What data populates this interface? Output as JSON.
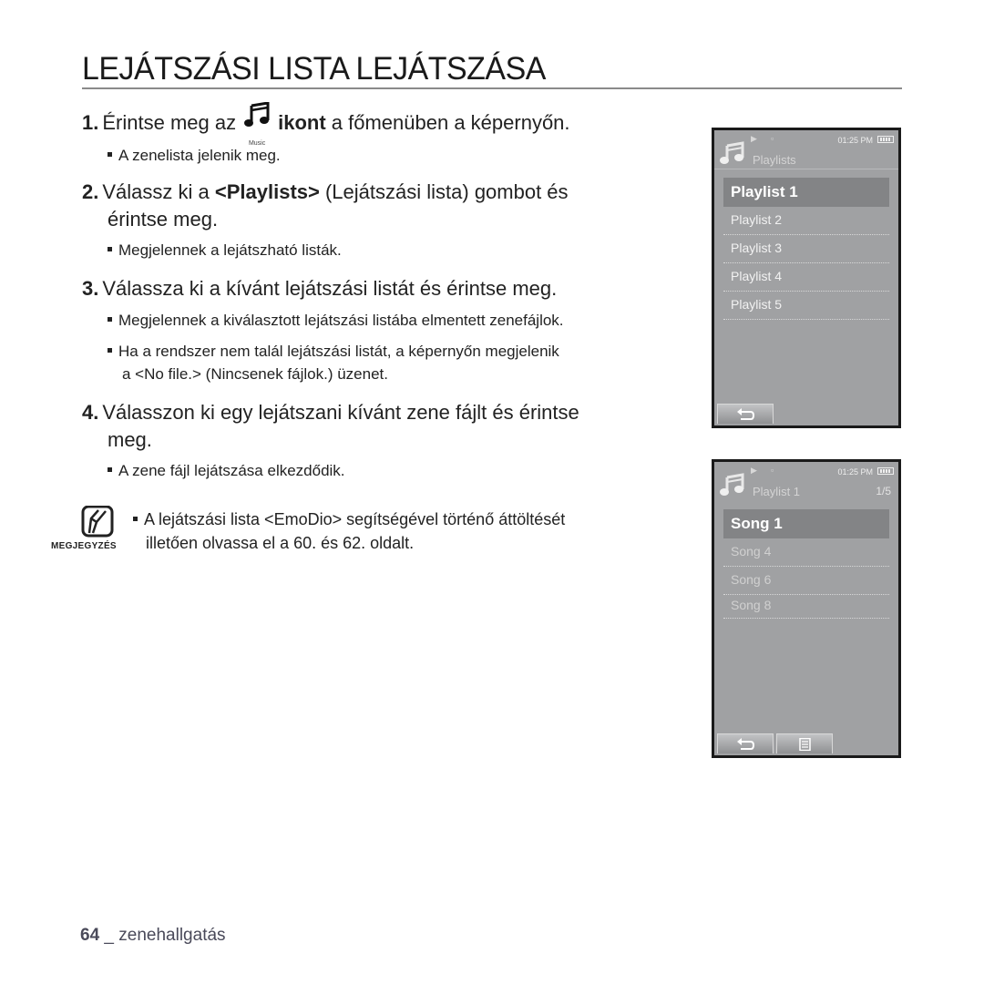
{
  "page": {
    "title": "LEJÁTSZÁSI LISTA LEJÁTSZÁSA",
    "footer": {
      "page_number": "64",
      "separator": "_",
      "section": "zenehallgatás"
    }
  },
  "steps": [
    {
      "num": "1.",
      "text_before": "Érintse meg az",
      "icon": "music-icon",
      "icon_label": "Music",
      "text_bold": "ikont",
      "text_after": "a főmenüben a képernyőn.",
      "bullets": [
        "A zenelista jelenik meg."
      ]
    },
    {
      "num": "2.",
      "text_before": "Válassz ki a",
      "text_bold": "<Playlists>",
      "text_after": "(Lejátszási lista) gombot és",
      "text_line2": "érintse meg.",
      "bullets": [
        "Megjelennek a lejátszható listák."
      ]
    },
    {
      "num": "3.",
      "text": "Válassza ki a kívánt lejátszási listát és érintse meg.",
      "bullets": [
        "Megjelennek a kiválasztott lejátszási listába elmentett zenefájlok.",
        "Ha a rendszer nem talál lejátszási listát, a képernyőn megjelenik",
        "a <No file.> (Nincsenek fájlok.) üzenet."
      ]
    },
    {
      "num": "4.",
      "text": "Válasszon ki egy lejátszani kívánt zene fájlt és érintse",
      "text_line2": "meg.",
      "bullets": [
        "A zene fájl lejátszása elkezdődik."
      ]
    }
  ],
  "note": {
    "icon": "pencil-note-icon",
    "label": "MEGJEGYZÉS",
    "line1": "A lejátszási lista <EmoDio> segítségével történő áttöltését",
    "line2": "illetően olvassa el a 60. és 62. oldalt."
  },
  "screens": [
    {
      "status": {
        "time": "01:25 PM",
        "icons": [
          "play-icon",
          "lock-icon"
        ],
        "battery": "battery-full-icon"
      },
      "header": {
        "title": "Playlists",
        "count": ""
      },
      "items": [
        "Playlist 1",
        "Playlist 2",
        "Playlist 3",
        "Playlist 4",
        "Playlist 5"
      ],
      "selected_index": 0,
      "buttons": [
        "back-button"
      ]
    },
    {
      "status": {
        "time": "01:25 PM",
        "icons": [
          "play-icon",
          "lock-icon"
        ],
        "battery": "battery-full-icon"
      },
      "header": {
        "title": "Playlist 1",
        "count": "1/5"
      },
      "items": [
        "Song 1",
        "Song 4",
        "Song 6",
        "Song 8"
      ],
      "selected_index": 0,
      "buttons": [
        "back-button",
        "menu-button"
      ]
    }
  ],
  "colors": {
    "screen_bg": "#a0a1a3",
    "selected_bg": "#838486",
    "frame": "#1a1a1a",
    "rule": "#8a8a8a"
  }
}
